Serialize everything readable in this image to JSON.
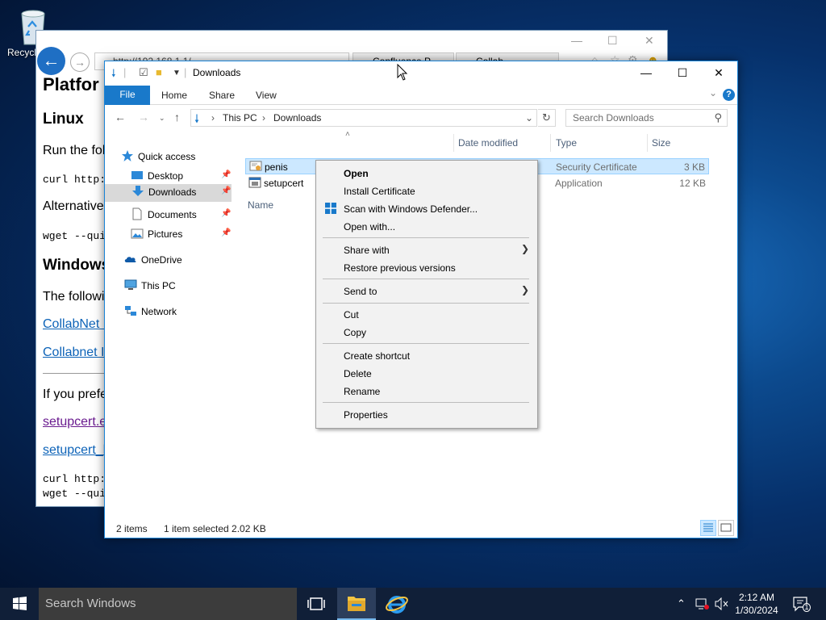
{
  "desktop": {
    "recycle_bin_label": "Recycl"
  },
  "browser": {
    "address": "http://192.168.1.1/",
    "tab1": "Confluence P...",
    "tab2": "Collab...",
    "content": {
      "h1": "Platfor",
      "linux_heading": "Linux",
      "run_text": "Run the fol",
      "curl1": "curl http:",
      "alt_text": "Alternative",
      "wget1": "wget --qui",
      "windows_heading": "Windows",
      "following_text": "The followi",
      "link1": "CollabNet I",
      "link2": "Collabnet I",
      "prefer_text": "If you prefe",
      "link3": "setupcert.e",
      "link4": "setupcert_l",
      "curl2": "curl http:",
      "wget2": "wget --qui"
    }
  },
  "explorer": {
    "title": "Downloads",
    "ribbon": {
      "file": "File",
      "home": "Home",
      "share": "Share",
      "view": "View"
    },
    "address": {
      "segment1": "This PC",
      "segment2": "Downloads"
    },
    "search_placeholder": "Search Downloads",
    "nav": {
      "quick_access": "Quick access",
      "desktop": "Desktop",
      "downloads": "Downloads",
      "documents": "Documents",
      "pictures": "Pictures",
      "onedrive": "OneDrive",
      "this_pc": "This PC",
      "network": "Network"
    },
    "columns": {
      "name": "Name",
      "date": "Date modified",
      "type": "Type",
      "size": "Size"
    },
    "files": [
      {
        "name": "penis",
        "type": "Security Certificate",
        "size": "3 KB"
      },
      {
        "name": "setupcert",
        "type": "Application",
        "size": "12 KB"
      }
    ],
    "status": {
      "items": "2 items",
      "selected": "1 item selected  2.02 KB"
    }
  },
  "context_menu": {
    "open": "Open",
    "install_certificate": "Install Certificate",
    "scan": "Scan with Windows Defender...",
    "open_with": "Open with...",
    "share_with": "Share with",
    "restore": "Restore previous versions",
    "send_to": "Send to",
    "cut": "Cut",
    "copy": "Copy",
    "create_shortcut": "Create shortcut",
    "delete": "Delete",
    "rename": "Rename",
    "properties": "Properties"
  },
  "taskbar": {
    "search_placeholder": "Search Windows",
    "time": "2:12 AM",
    "date": "1/30/2024",
    "notification_count": "1"
  }
}
